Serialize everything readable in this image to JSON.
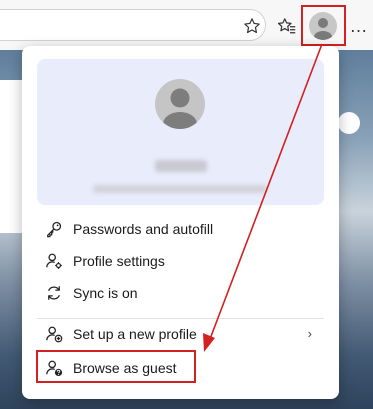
{
  "toolbar": {
    "icons": [
      "star-icon",
      "favorites-icon",
      "profile-icon",
      "more-icon"
    ],
    "more_glyph": "…"
  },
  "profile_flyout": {
    "menu": [
      {
        "label": "Passwords and autofill",
        "icon": "key-icon"
      },
      {
        "label": "Profile settings",
        "icon": "profile-settings-icon"
      },
      {
        "label": "Sync is on",
        "icon": "sync-icon"
      },
      {
        "label": "Set up a new profile",
        "icon": "add-profile-icon",
        "chevron": "›"
      },
      {
        "label": "Browse as guest",
        "icon": "guest-icon"
      }
    ]
  },
  "colors": {
    "highlight": "#d32020",
    "card": "#e8ecfb"
  }
}
